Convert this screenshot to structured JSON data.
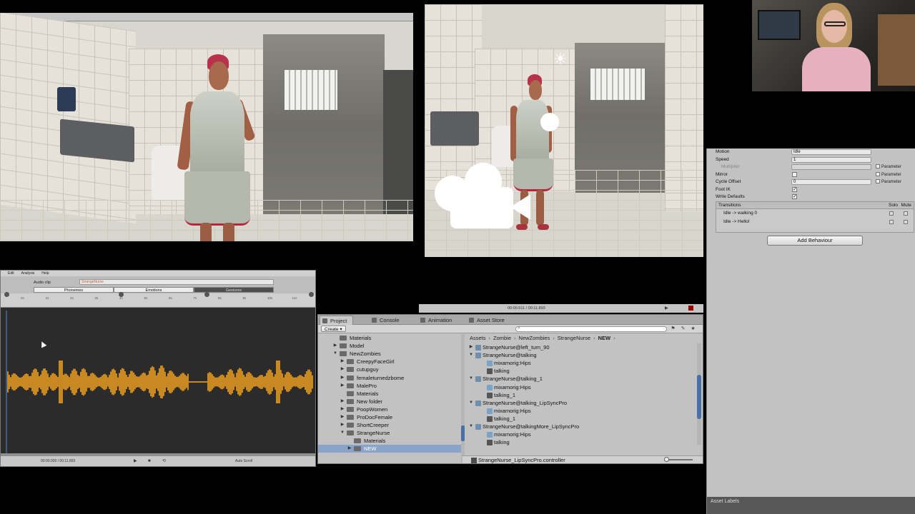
{
  "inspector": {
    "rows": [
      {
        "label": "Motion",
        "value": "Idle",
        "kind": "field"
      },
      {
        "label": "Speed",
        "value": "1",
        "kind": "field"
      },
      {
        "label": "Multiplier",
        "value": "",
        "kind": "dim",
        "param": "Parameter"
      },
      {
        "label": "Mirror",
        "value": "",
        "kind": "check",
        "param": "Parameter"
      },
      {
        "label": "Cycle Offset",
        "value": "0",
        "kind": "field",
        "param": "Parameter"
      },
      {
        "label": "Foot IK",
        "value": "✓",
        "kind": "check"
      },
      {
        "label": "Write Defaults",
        "value": "✓",
        "kind": "check"
      }
    ],
    "transitions_title": "Transitions",
    "solo_label": "Solo",
    "mute_label": "Mute",
    "transitions": [
      "Idle -> walking 0",
      "Idle -> Hello!"
    ],
    "add_behaviour": "Add Behaviour",
    "asset_labels": "Asset Labels"
  },
  "audio": {
    "menu": [
      "Edit",
      "Analysis",
      "Help"
    ],
    "clip_label": "Audio clip",
    "clip_value": "StrangeNurse",
    "tabs": [
      "Phonemes",
      "Emotions",
      "Gestures"
    ],
    "active_tab": 2,
    "ruler_ticks": [
      "0s",
      "1s",
      "2s",
      "3s",
      "4s",
      "5s",
      "6s",
      "7s",
      "8s",
      "9s",
      "10s",
      "11s"
    ],
    "status_left": "00:00.000 / 00:11.893",
    "status_right": "Auto Scroll",
    "wave_color": "#f0a020"
  },
  "anim_strip": {
    "time": "00:00.511 / 00:11.893"
  },
  "project": {
    "tabs": [
      "Project",
      "Console",
      "Animation",
      "Asset Store"
    ],
    "active_tab": 0,
    "create": "Create",
    "tree": [
      {
        "name": "Materials",
        "depth": 1,
        "arrow": ""
      },
      {
        "name": "Model",
        "depth": 1,
        "arrow": "▶"
      },
      {
        "name": "NewZombies",
        "depth": 1,
        "arrow": "▼"
      },
      {
        "name": "CreepyFaceGirl",
        "depth": 2,
        "arrow": "▶"
      },
      {
        "name": "cutupguy",
        "depth": 2,
        "arrow": "▶"
      },
      {
        "name": "femaleturnedzbome",
        "depth": 2,
        "arrow": "▶"
      },
      {
        "name": "MalePro",
        "depth": 2,
        "arrow": "▶"
      },
      {
        "name": "Materials",
        "depth": 2,
        "arrow": ""
      },
      {
        "name": "New folder",
        "depth": 2,
        "arrow": "▶"
      },
      {
        "name": "PoopWomen",
        "depth": 2,
        "arrow": "▶"
      },
      {
        "name": "ProDocFemale",
        "depth": 2,
        "arrow": "▶"
      },
      {
        "name": "ShortCreeper",
        "depth": 2,
        "arrow": "▶"
      },
      {
        "name": "StrangeNurse",
        "depth": 2,
        "arrow": "▼"
      },
      {
        "name": "Materials",
        "depth": 3,
        "arrow": ""
      },
      {
        "name": "NEW",
        "depth": 3,
        "arrow": "▶",
        "selected": true
      }
    ],
    "breadcrumb": [
      "Assets",
      "Zombie",
      "NewZombies",
      "StrangeNurse",
      "NEW"
    ],
    "assets": [
      {
        "name": "StrangeNurse@left_turn_90",
        "depth": 0,
        "arrow": "▶",
        "icon": "model"
      },
      {
        "name": "StrangeNurse@talking",
        "depth": 0,
        "arrow": "▼",
        "icon": "model"
      },
      {
        "name": "mixamorig:Hips",
        "depth": 1,
        "arrow": "",
        "icon": "bone"
      },
      {
        "name": "talking",
        "depth": 1,
        "arrow": "",
        "icon": "clip"
      },
      {
        "name": "StrangeNurse@talking_1",
        "depth": 0,
        "arrow": "▼",
        "icon": "model"
      },
      {
        "name": "mixamorig:Hips",
        "depth": 1,
        "arrow": "",
        "icon": "bone"
      },
      {
        "name": "talking_1",
        "depth": 1,
        "arrow": "",
        "icon": "clip"
      },
      {
        "name": "StrangeNurse@talking_LipSyncPro",
        "depth": 0,
        "arrow": "▼",
        "icon": "model"
      },
      {
        "name": "mixamorig:Hips",
        "depth": 1,
        "arrow": "",
        "icon": "bone"
      },
      {
        "name": "talking_1",
        "depth": 1,
        "arrow": "",
        "icon": "clip"
      },
      {
        "name": "StrangeNurse@talkingMore_LipSyncPro",
        "depth": 0,
        "arrow": "▼",
        "icon": "model"
      },
      {
        "name": "mixamorig:Hips",
        "depth": 1,
        "arrow": "",
        "icon": "bone"
      },
      {
        "name": "talking",
        "depth": 1,
        "arrow": "",
        "icon": "clip"
      }
    ],
    "bottom_item": "StrangeNurse_LipSyncPro.controller"
  }
}
